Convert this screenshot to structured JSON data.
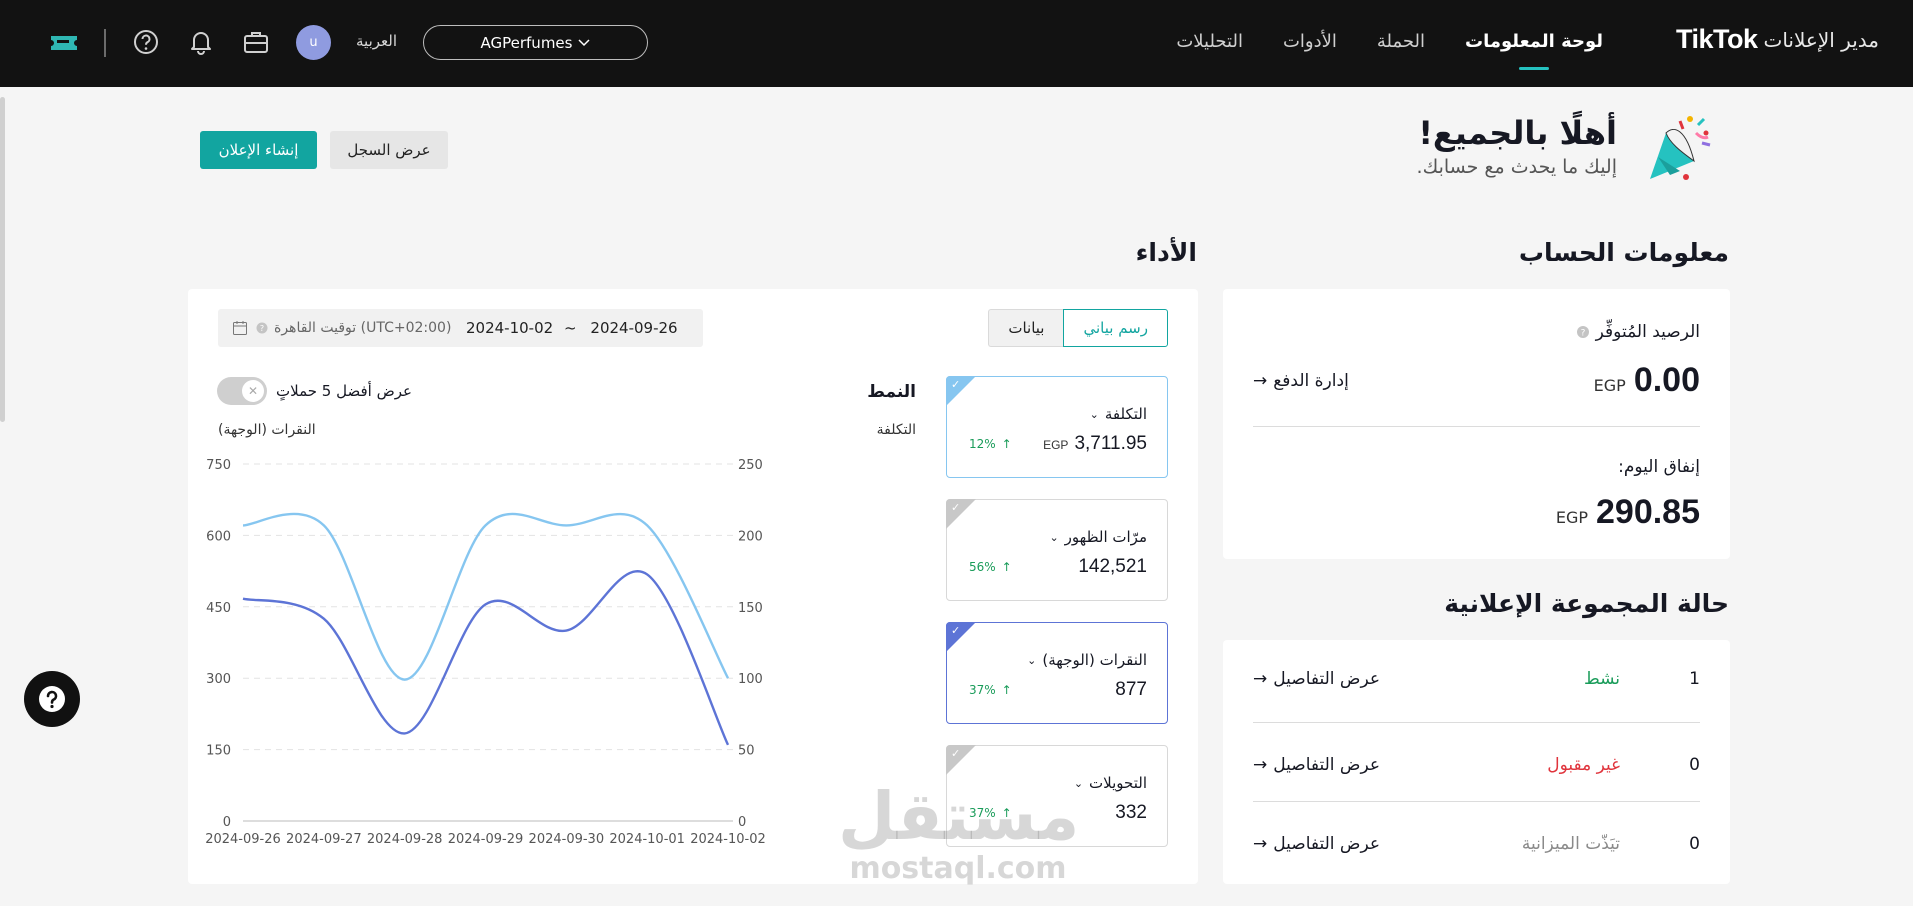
{
  "header": {
    "brand_product": "مدير الإعلانات",
    "brand_logo": "TikTok",
    "nav": [
      {
        "label": "لوحة المعلومات",
        "active": true
      },
      {
        "label": "الحملة",
        "active": false
      },
      {
        "label": "الأدوات",
        "active": false
      },
      {
        "label": "التحليلات",
        "active": false
      }
    ],
    "account_name": "AGPerfumes",
    "language": "العربية",
    "avatar_letter": "u",
    "icons": [
      "ticket-icon",
      "help-circle-icon",
      "bell-icon",
      "briefcase-icon"
    ]
  },
  "welcome": {
    "title": "أهلًا بالجميع!",
    "subtitle": "إليك ما يحدث مع حسابك.",
    "history_button": "عرض السجل",
    "create_button": "إنشاء الإعلان"
  },
  "account_info": {
    "title": "معلومات الحساب",
    "balance_label": "الرصيد المُتوفِّر",
    "balance_currency": "EGP",
    "balance_value": "0.00",
    "manage_payment": "إدارة الدفع",
    "today_spend_label": "إنفاق اليوم:",
    "today_currency": "EGP",
    "today_value": "290.85"
  },
  "adgroup_status": {
    "title": "حالة المجموعة الإعلانية",
    "rows": [
      {
        "count": "1",
        "status": "نشط",
        "color": "#1a9c5a",
        "link": "عرض التفاصيل"
      },
      {
        "count": "0",
        "status": "غير مقبول",
        "color": "#e0343c",
        "link": "عرض التفاصيل"
      },
      {
        "count": "0",
        "status": "تيَذّت الميزانية",
        "color": "#8a8a8a",
        "link": "عرض التفاصيل"
      }
    ]
  },
  "performance": {
    "title": "الأداء",
    "tab_chart": "رسم بياني",
    "tab_data": "بيانات",
    "date_start": "2024-09-26",
    "date_sep": "~",
    "date_end": "2024-10-02",
    "timezone": "(UTC+02:00) توقيت القاهرة",
    "pattern_label": "النمط",
    "top5_label": "عرض أفضل 5 حملاتٍ",
    "top5_enabled": false,
    "metrics": [
      {
        "name": "التكلفة",
        "currency": "EGP",
        "value": "3,711.95",
        "change": "12%",
        "selected": true,
        "color": "#86c6f0"
      },
      {
        "name": "مرّات الظهور",
        "currency": "",
        "value": "142,521",
        "change": "56%",
        "selected": false,
        "color": "#c8c8c8"
      },
      {
        "name": "النقرات (الوجهة)",
        "currency": "",
        "value": "877",
        "change": "37%",
        "selected": true,
        "color": "#5d74d6"
      },
      {
        "name": "التحويلات",
        "currency": "",
        "value": "332",
        "change": "37%",
        "selected": false,
        "color": "#c8c8c8"
      }
    ]
  },
  "chart_data": {
    "type": "line",
    "x": [
      "2024-09-26",
      "2024-09-27",
      "2024-09-28",
      "2024-09-29",
      "2024-09-30",
      "2024-10-01",
      "2024-10-02"
    ],
    "left_axis_label": "النقرات (الوجهة)",
    "right_axis_label": "التكلفة",
    "left_ticks": [
      0,
      150,
      300,
      450,
      600,
      750
    ],
    "right_ticks": [
      0,
      50,
      100,
      150,
      200,
      250
    ],
    "ylim_left": [
      0,
      750
    ],
    "ylim_right": [
      0,
      250
    ],
    "grid": true,
    "series": [
      {
        "name": "التكلفة",
        "axis": "right",
        "color": "#86c6f0",
        "values": [
          207,
          207,
          99,
          207,
          207,
          207,
          100
        ]
      },
      {
        "name": "النقرات (الوجهة)",
        "axis": "left",
        "color": "#5d74d6",
        "values": [
          467,
          425,
          184,
          455,
          400,
          518,
          160
        ]
      }
    ]
  },
  "watermark": {
    "arabic": "مستقل",
    "latin": "mostaql.com"
  }
}
